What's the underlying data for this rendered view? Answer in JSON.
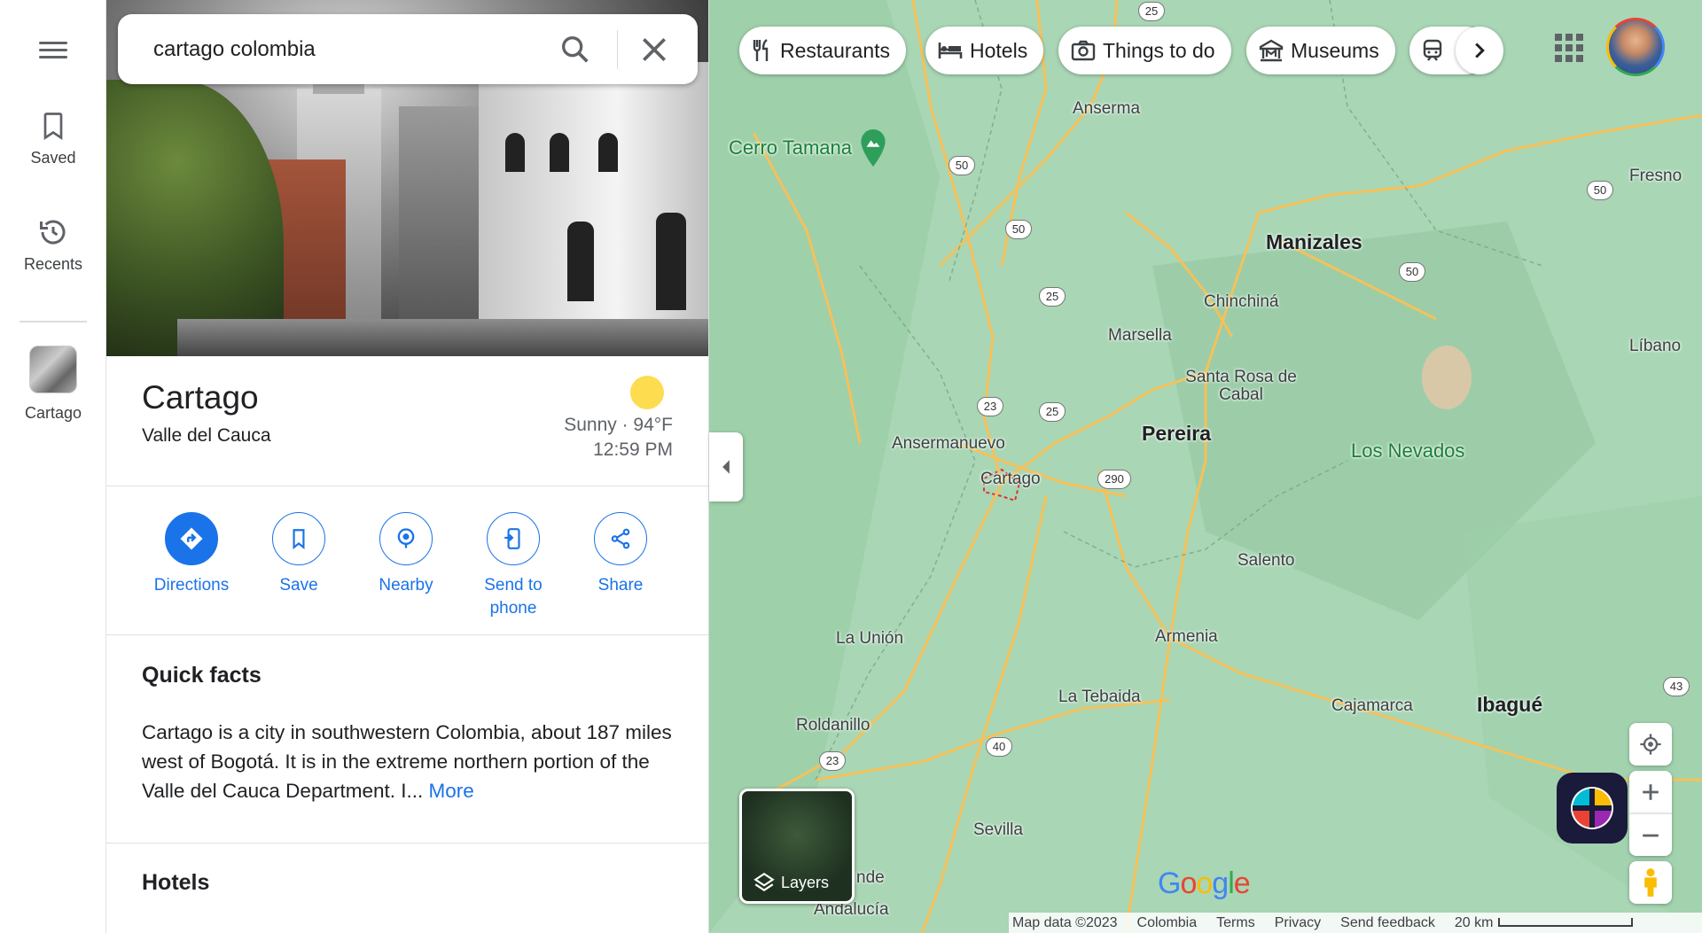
{
  "search": {
    "value": "cartago colombia"
  },
  "rail": {
    "saved_label": "Saved",
    "recents_label": "Recents",
    "recent_place_label": "Cartago"
  },
  "place": {
    "name": "Cartago",
    "subtitle": "Valle del Cauca",
    "weather": "Sunny · 94°F",
    "time": "12:59 PM"
  },
  "actions": [
    {
      "label": "Directions"
    },
    {
      "label": "Save"
    },
    {
      "label": "Nearby"
    },
    {
      "label": "Send to phone"
    },
    {
      "label": "Share"
    }
  ],
  "quick_facts": {
    "title": "Quick facts",
    "text": "Cartago is a city in southwestern Colombia, about 187 miles west of Bogotá. It is in the extreme northern portion of the Valle del Cauca Department. I... ",
    "more_label": "More"
  },
  "hotels_title": "Hotels",
  "chips": [
    {
      "label": "Restaurants",
      "icon": "fork-knife-icon"
    },
    {
      "label": "Hotels",
      "icon": "bed-icon"
    },
    {
      "label": "Things to do",
      "icon": "camera-icon"
    },
    {
      "label": "Museums",
      "icon": "museum-icon"
    }
  ],
  "map": {
    "labels": {
      "anserma": "Anserma",
      "cerro_tamana": "Cerro Tamana",
      "manizales": "Manizales",
      "fresno": "Fresno",
      "chinchina": "Chinchiná",
      "marsella": "Marsella",
      "libano": "Líbano",
      "santa_rosa": "Santa Rosa de Cabal",
      "ansermanuevo": "Ansermanuevo",
      "pereira": "Pereira",
      "los_nevados": "Los Nevados",
      "cartago": "Cartago",
      "salento": "Salento",
      "la_union": "La Unión",
      "armenia": "Armenia",
      "la_tebaida": "La Tebaida",
      "cajamarca": "Cajamarca",
      "ibague": "Ibagué",
      "roldanillo": "Roldanillo",
      "sevilla": "Sevilla",
      "zarzal_partial": "nde",
      "andalucia": "Andalucía"
    },
    "shields": {
      "s25_top": "25",
      "s50_a": "50",
      "s50_b": "50",
      "s50_c": "50",
      "s50_d": "50",
      "s25_a": "25",
      "s23_a": "23",
      "s25_b": "25",
      "s290": "290",
      "s40": "40",
      "s23_b": "23",
      "s43": "43"
    },
    "layers_label": "Layers",
    "google_logo": "Google"
  },
  "footer": {
    "map_data": "Map data ©2023",
    "country": "Colombia",
    "terms": "Terms",
    "privacy": "Privacy",
    "feedback": "Send feedback",
    "scale": "20 km"
  },
  "colors": {
    "accent": "#1a73e8",
    "map_green": "#a9d6b4",
    "road_yellow": "#f5c15a"
  }
}
